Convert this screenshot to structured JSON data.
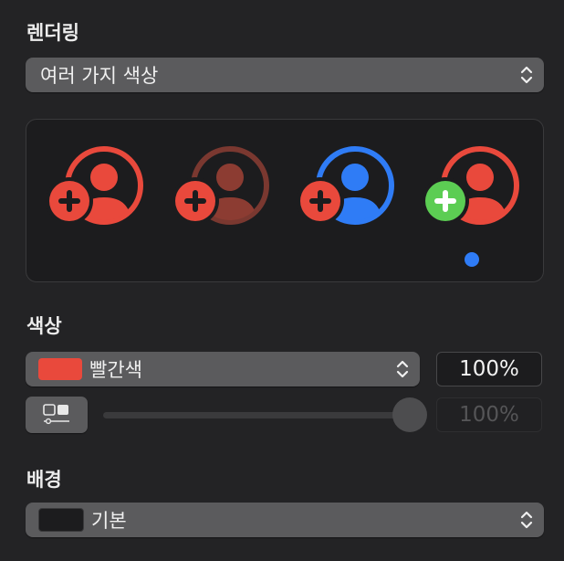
{
  "rendering": {
    "title": "렌더링",
    "mode_value": "여러 가지 색상"
  },
  "preview": {
    "variants": [
      {
        "name": "multicolor",
        "ring": "#e9493c",
        "person": "#e9493c",
        "badge": "#e9493c",
        "plus": "#1c1c1e"
      },
      {
        "name": "hierarchical",
        "ring": "#7a3830",
        "person": "#8c3c32",
        "badge": "#e9493c",
        "plus": "#1c1c1e"
      },
      {
        "name": "palette",
        "ring": "#2f7cf6",
        "person": "#2f7cf6",
        "badge": "#e9493c",
        "plus": "#1c1c1e"
      },
      {
        "name": "multicolor-selected",
        "ring": "#e9493c",
        "person": "#e9493c",
        "badge": "#5ccd53",
        "plus": "#ffffff"
      }
    ],
    "selected_indicator_color": "#2f7cf6"
  },
  "color": {
    "title": "색상",
    "swatch_color": "#e9493c",
    "primary_value": "빨간색",
    "primary_opacity": "100%",
    "secondary_opacity": "100%",
    "slider_value_percent": 100
  },
  "background": {
    "title": "배경",
    "swatch_color": "#1c1c1e",
    "value": "기본"
  }
}
